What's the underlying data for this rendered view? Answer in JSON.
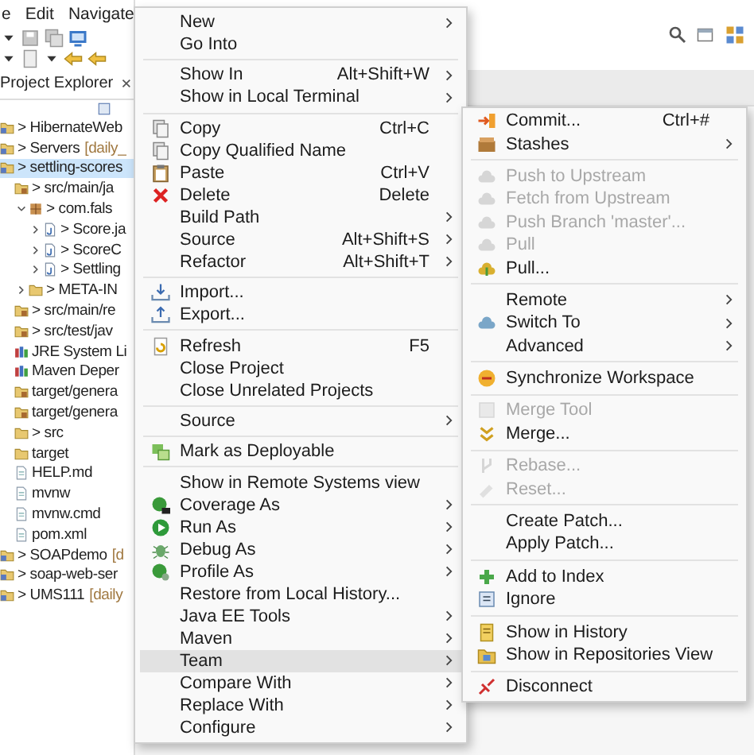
{
  "menu_bar": [
    {
      "label": "e"
    },
    {
      "label": "Edit"
    },
    {
      "label": "Navigate"
    }
  ],
  "explorer": {
    "title": "Project Explorer",
    "tree": [
      {
        "label": "> HibernateWeb",
        "kind": "project",
        "selected": false
      },
      {
        "label": "> Servers",
        "branch": "[daily_",
        "kind": "project",
        "selected": false
      },
      {
        "label": "> settling-scores",
        "kind": "project",
        "selected": true,
        "children": [
          {
            "label": "> src/main/ja",
            "kind": "source-folder",
            "selected": false,
            "children": [
              {
                "label": "> com.fals",
                "kind": "package",
                "selected": false,
                "expanded": true,
                "children": [
                  {
                    "label": "> Score.ja",
                    "kind": "java-file",
                    "selected": false,
                    "expanded": false
                  },
                  {
                    "label": "> ScoreC",
                    "kind": "java-file",
                    "selected": false,
                    "expanded": false
                  },
                  {
                    "label": "> Settling",
                    "kind": "java-file",
                    "selected": false,
                    "expanded": false
                  }
                ]
              },
              {
                "label": "> META-IN",
                "kind": "folder",
                "selected": false,
                "expanded": false
              }
            ]
          },
          {
            "label": "> src/main/re",
            "kind": "source-folder",
            "selected": false
          },
          {
            "label": "> src/test/jav",
            "kind": "source-folder",
            "selected": false
          },
          {
            "label": "JRE System Li",
            "kind": "library",
            "selected": false
          },
          {
            "label": "Maven Deper",
            "kind": "library",
            "selected": false
          },
          {
            "label": "target/genera",
            "kind": "source-folder",
            "selected": false
          },
          {
            "label": "target/genera",
            "kind": "source-folder",
            "selected": false
          },
          {
            "label": "> src",
            "kind": "folder",
            "selected": false
          },
          {
            "label": "target",
            "kind": "folder",
            "selected": false
          },
          {
            "label": "HELP.md",
            "kind": "file",
            "selected": false
          },
          {
            "label": "mvnw",
            "kind": "file",
            "selected": false
          },
          {
            "label": "mvnw.cmd",
            "kind": "file",
            "selected": false
          },
          {
            "label": "pom.xml",
            "kind": "file",
            "selected": false
          }
        ]
      },
      {
        "label": "> SOAPdemo",
        "branch": "[d",
        "kind": "project",
        "selected": false
      },
      {
        "label": "> soap-web-ser",
        "kind": "project",
        "selected": false
      },
      {
        "label": "> UMS111",
        "branch": "[daily",
        "kind": "project",
        "selected": false
      }
    ]
  },
  "context_menu": {
    "groups": [
      [
        {
          "label": "New",
          "submenu": true,
          "selected": false
        },
        {
          "label": "Go Into",
          "submenu": false,
          "selected": false
        }
      ],
      [
        {
          "label": "Show In",
          "shortcut": "Alt+Shift+W",
          "submenu": true,
          "selected": false
        },
        {
          "label": "Show in Local Terminal",
          "submenu": true,
          "selected": false
        }
      ],
      [
        {
          "label": "Copy",
          "shortcut": "Ctrl+C",
          "submenu": false,
          "selected": false
        },
        {
          "label": "Copy Qualified Name",
          "submenu": false,
          "selected": false
        },
        {
          "label": "Paste",
          "shortcut": "Ctrl+V",
          "submenu": false,
          "selected": false
        },
        {
          "label": "Delete",
          "shortcut": "Delete",
          "submenu": false,
          "selected": false
        },
        {
          "label": "Build Path",
          "submenu": true,
          "selected": false
        },
        {
          "label": "Source",
          "shortcut": "Alt+Shift+S",
          "submenu": true,
          "selected": false
        },
        {
          "label": "Refactor",
          "shortcut": "Alt+Shift+T",
          "submenu": true,
          "selected": false
        }
      ],
      [
        {
          "label": "Import...",
          "submenu": false,
          "selected": false
        },
        {
          "label": "Export...",
          "submenu": false,
          "selected": false
        }
      ],
      [
        {
          "label": "Refresh",
          "shortcut": "F5",
          "submenu": false,
          "selected": false
        },
        {
          "label": "Close Project",
          "submenu": false,
          "selected": false
        },
        {
          "label": "Close Unrelated Projects",
          "submenu": false,
          "selected": false
        }
      ],
      [
        {
          "label": "Source",
          "submenu": true,
          "selected": false
        }
      ],
      [
        {
          "label": "Mark as Deployable",
          "submenu": false,
          "selected": false
        }
      ],
      [
        {
          "label": "Show in Remote Systems view",
          "submenu": false,
          "selected": false
        },
        {
          "label": "Coverage As",
          "submenu": true,
          "selected": false
        },
        {
          "label": "Run As",
          "submenu": true,
          "selected": false
        },
        {
          "label": "Debug As",
          "submenu": true,
          "selected": false
        },
        {
          "label": "Profile As",
          "submenu": true,
          "selected": false
        },
        {
          "label": "Restore from Local History...",
          "submenu": false,
          "selected": false
        },
        {
          "label": "Java EE Tools",
          "submenu": true,
          "selected": false
        },
        {
          "label": "Maven",
          "submenu": true,
          "selected": false
        },
        {
          "label": "Team",
          "submenu": true,
          "selected": true
        },
        {
          "label": "Compare With",
          "submenu": true,
          "selected": false
        },
        {
          "label": "Replace With",
          "submenu": true,
          "selected": false
        },
        {
          "label": "Configure",
          "submenu": true,
          "selected": false
        }
      ]
    ]
  },
  "team_submenu": {
    "groups": [
      [
        {
          "label": "Commit...",
          "shortcut": "Ctrl+#",
          "submenu": false,
          "disabled": false
        },
        {
          "label": "Stashes",
          "submenu": true,
          "disabled": false
        }
      ],
      [
        {
          "label": "Push to Upstream",
          "submenu": false,
          "disabled": true
        },
        {
          "label": "Fetch from Upstream",
          "submenu": false,
          "disabled": true
        },
        {
          "label": "Push Branch 'master'...",
          "submenu": false,
          "disabled": true
        },
        {
          "label": "Pull",
          "submenu": false,
          "disabled": true
        },
        {
          "label": "Pull...",
          "submenu": false,
          "disabled": false
        }
      ],
      [
        {
          "label": "Remote",
          "submenu": true,
          "disabled": false
        },
        {
          "label": "Switch To",
          "submenu": true,
          "disabled": false
        },
        {
          "label": "Advanced",
          "submenu": true,
          "disabled": false
        }
      ],
      [
        {
          "label": "Synchronize Workspace",
          "submenu": false,
          "disabled": false
        }
      ],
      [
        {
          "label": "Merge Tool",
          "submenu": false,
          "disabled": true
        },
        {
          "label": "Merge...",
          "submenu": false,
          "disabled": false
        }
      ],
      [
        {
          "label": "Rebase...",
          "submenu": false,
          "disabled": true
        },
        {
          "label": "Reset...",
          "submenu": false,
          "disabled": true
        }
      ],
      [
        {
          "label": "Create Patch...",
          "submenu": false,
          "disabled": false
        },
        {
          "label": "Apply Patch...",
          "submenu": false,
          "disabled": false
        }
      ],
      [
        {
          "label": "Add to Index",
          "submenu": false,
          "disabled": false
        },
        {
          "label": "Ignore",
          "submenu": false,
          "disabled": false
        }
      ],
      [
        {
          "label": "Show in History",
          "submenu": false,
          "disabled": false
        },
        {
          "label": "Show in Repositories View",
          "submenu": false,
          "disabled": false
        }
      ],
      [
        {
          "label": "Disconnect",
          "submenu": false,
          "disabled": false
        }
      ]
    ]
  }
}
